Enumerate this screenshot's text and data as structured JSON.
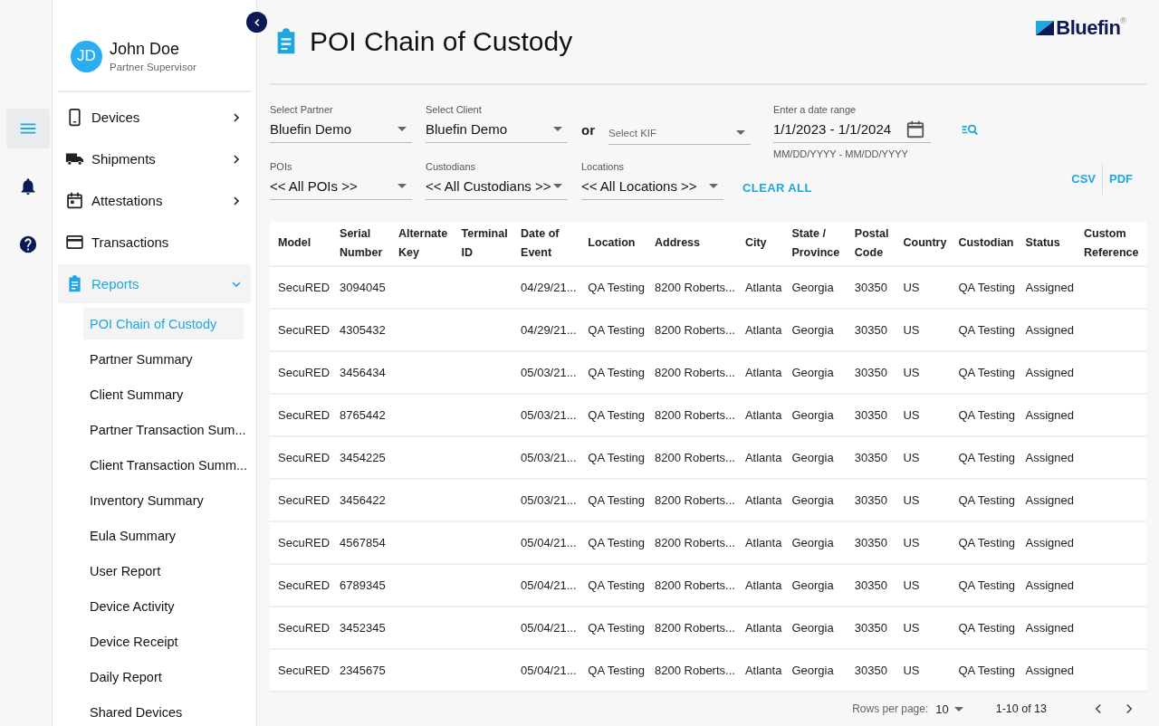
{
  "rail": {
    "items": [
      {
        "kind": "menu",
        "selected": true
      },
      {
        "kind": "bell",
        "selected": false
      },
      {
        "kind": "help",
        "selected": false
      }
    ]
  },
  "user": {
    "initials": "JD",
    "name": "John Doe",
    "role": "Partner Supervisor"
  },
  "nav": [
    {
      "kind": "devices",
      "label": "Devices",
      "expandable": true,
      "expanded": false,
      "selected": false
    },
    {
      "kind": "shipments",
      "label": "Shipments",
      "expandable": true,
      "expanded": false,
      "selected": false
    },
    {
      "kind": "attestations",
      "label": "Attestations",
      "expandable": true,
      "expanded": false,
      "selected": false
    },
    {
      "kind": "transactions",
      "label": "Transactions",
      "expandable": false,
      "expanded": false,
      "selected": false
    },
    {
      "kind": "reports",
      "label": "Reports",
      "expandable": true,
      "expanded": true,
      "selected": true,
      "children": [
        {
          "label": "POI Chain of Custody",
          "selected": true
        },
        {
          "label": "Partner Summary",
          "selected": false
        },
        {
          "label": "Client Summary",
          "selected": false
        },
        {
          "label": "Partner Transaction Sum...",
          "selected": false
        },
        {
          "label": "Client Transaction Summ...",
          "selected": false
        },
        {
          "label": "Inventory Summary",
          "selected": false
        },
        {
          "label": "Eula Summary",
          "selected": false
        },
        {
          "label": "User Report",
          "selected": false
        },
        {
          "label": "Device Activity",
          "selected": false
        },
        {
          "label": "Device Receipt",
          "selected": false
        },
        {
          "label": "Daily Report",
          "selected": false
        },
        {
          "label": "Shared Devices",
          "selected": false
        }
      ]
    }
  ],
  "page": {
    "title": "POI Chain of Custody",
    "logo": "Bluefin",
    "logo_mark": "®"
  },
  "filters": {
    "partner": {
      "label": "Select Partner",
      "value": "Bluefin Demo"
    },
    "client": {
      "label": "Select Client",
      "value": "Bluefin Demo"
    },
    "or": "or",
    "kif": {
      "placeholder": "Select KIF"
    },
    "date_range": {
      "label": "Enter a date range",
      "value": "1/1/2023 - 1/1/2024",
      "hint": "MM/DD/YYYY - MM/DD/YYYY"
    },
    "pois": {
      "label": "POIs",
      "value": "<<  All POIs >>"
    },
    "custodians": {
      "label": "Custodians",
      "value": "<< All Custodians >>"
    },
    "locations": {
      "label": "Locations",
      "value": "<< All Locations >>"
    },
    "clear_all": "CLEAR ALL"
  },
  "exports": [
    "CSV",
    "PDF"
  ],
  "table": {
    "columns": [
      "Model",
      "Serial Number",
      "Alternate Key",
      "Terminal ID",
      "Date of Event",
      "Location",
      "Address",
      "City",
      "State / Province",
      "Postal Code",
      "Country",
      "Custodian",
      "Status",
      "Custom Reference"
    ],
    "rows": [
      [
        "SecuRED",
        "3094045",
        null,
        null,
        "04/29/21...",
        "QA Testing",
        "8200 Roberts...",
        "Atlanta",
        "Georgia",
        "30350",
        "US",
        "QA Testing",
        "Assigned",
        null
      ],
      [
        "SecuRED",
        "4305432",
        null,
        null,
        "04/29/21...",
        "QA Testing",
        "8200 Roberts...",
        "Atlanta",
        "Georgia",
        "30350",
        "US",
        "QA Testing",
        "Assigned",
        null
      ],
      [
        "SecuRED",
        "3456434",
        null,
        null,
        "05/03/21...",
        "QA Testing",
        "8200 Roberts...",
        "Atlanta",
        "Georgia",
        "30350",
        "US",
        "QA Testing",
        "Assigned",
        null
      ],
      [
        "SecuRED",
        "8765442",
        null,
        null,
        "05/03/21...",
        "QA Testing",
        "8200 Roberts...",
        "Atlanta",
        "Georgia",
        "30350",
        "US",
        "QA Testing",
        "Assigned",
        null
      ],
      [
        "SecuRED",
        "3454225",
        null,
        null,
        "05/03/21...",
        "QA Testing",
        "8200 Roberts...",
        "Atlanta",
        "Georgia",
        "30350",
        "US",
        "QA Testing",
        "Assigned",
        null
      ],
      [
        "SecuRED",
        "3456422",
        null,
        null,
        "05/03/21...",
        "QA Testing",
        "8200 Roberts...",
        "Atlanta",
        "Georgia",
        "30350",
        "US",
        "QA Testing",
        "Assigned",
        null
      ],
      [
        "SecuRED",
        "4567854",
        null,
        null,
        "05/04/21...",
        "QA Testing",
        "8200 Roberts...",
        "Atlanta",
        "Georgia",
        "30350",
        "US",
        "QA Testing",
        "Assigned",
        null
      ],
      [
        "SecuRED",
        "6789345",
        null,
        null,
        "05/04/21...",
        "QA Testing",
        "8200 Roberts...",
        "Atlanta",
        "Georgia",
        "30350",
        "US",
        "QA Testing",
        "Assigned",
        null
      ],
      [
        "SecuRED",
        "3452345",
        null,
        null,
        "05/04/21...",
        "QA Testing",
        "8200 Roberts...",
        "Atlanta",
        "Georgia",
        "30350",
        "US",
        "QA Testing",
        "Assigned",
        null
      ],
      [
        "SecuRED",
        "2345675",
        null,
        null,
        "05/04/21...",
        "QA Testing",
        "8200 Roberts...",
        "Atlanta",
        "Georgia",
        "30350",
        "US",
        "QA Testing",
        "Assigned",
        null
      ]
    ]
  },
  "pagination": {
    "rows_label": "Rows per page:",
    "rows_value": "10",
    "range": "1-10 of 13"
  }
}
